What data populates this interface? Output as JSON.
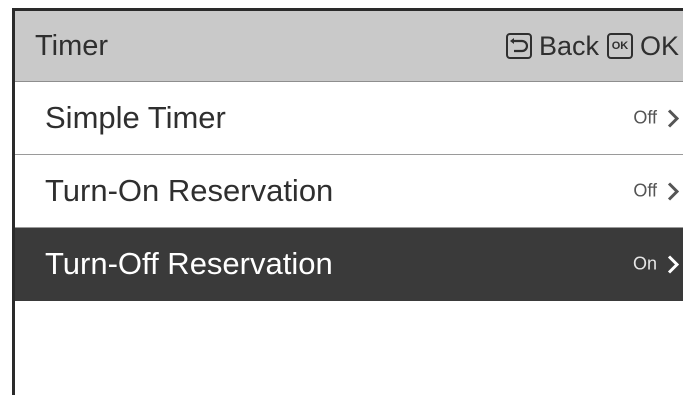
{
  "header": {
    "title": "Timer",
    "back_label": "Back",
    "ok_label": "OK",
    "ok_icon_text": "OK"
  },
  "menu": {
    "items": [
      {
        "label": "Simple Timer",
        "status": "Off",
        "selected": false
      },
      {
        "label": "Turn-On Reservation",
        "status": "Off",
        "selected": false
      },
      {
        "label": "Turn-Off Reservation",
        "status": "On",
        "selected": true
      }
    ]
  },
  "colors": {
    "header_bg": "#c9c9c9",
    "selected_bg": "#3a3a3a",
    "text": "#2f2f2f"
  },
  "icons": [
    "back-icon",
    "ok-icon",
    "chevron-right-icon"
  ]
}
